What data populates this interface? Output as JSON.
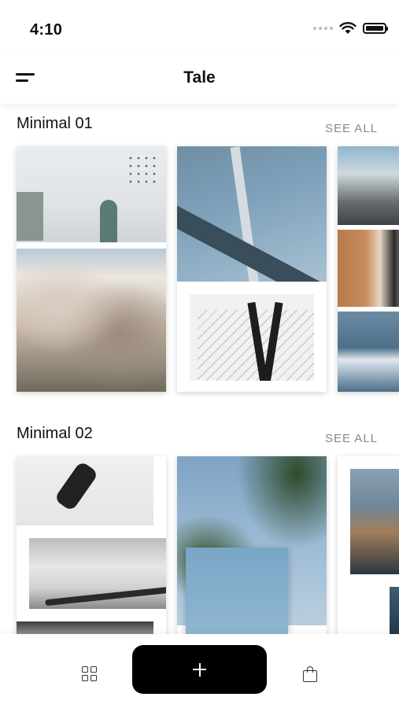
{
  "status_bar": {
    "time": "4:10",
    "icons": [
      "signal-dots-icon",
      "wifi-icon",
      "battery-icon"
    ]
  },
  "header": {
    "title": "Tale",
    "menu_icon": "menu-icon"
  },
  "sections": [
    {
      "title": "Minimal 01",
      "see_all_label": "SEE ALL"
    },
    {
      "title": "Minimal 02",
      "see_all_label": "SEE ALL"
    }
  ],
  "tab_bar": {
    "left_icon": "grid-icon",
    "center_icon": "plus-icon",
    "right_icon": "shopping-bag-icon",
    "accent_color": "#000000"
  }
}
